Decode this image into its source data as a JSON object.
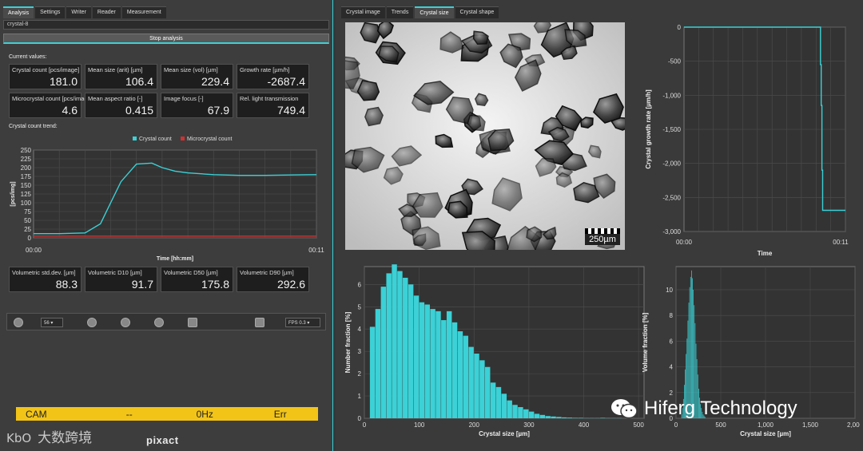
{
  "left_tabs": [
    {
      "label": "Analysis",
      "active": true
    },
    {
      "label": "Settings",
      "active": false
    },
    {
      "label": "Writer",
      "active": false
    },
    {
      "label": "Reader",
      "active": false
    },
    {
      "label": "Measurement",
      "active": false
    }
  ],
  "name_field": {
    "value": "crystal-8"
  },
  "stop_button": {
    "label": "Stop analysis"
  },
  "current_values_label": "Current values:",
  "current_values": [
    {
      "label": "Crystal count [pcs/image]",
      "value": "181.0"
    },
    {
      "label": "Mean size (arit) [µm]",
      "value": "106.4"
    },
    {
      "label": "Mean size (vol) [µm]",
      "value": "229.4"
    },
    {
      "label": "Growth rate [µm/h]",
      "value": "-2687.4"
    },
    {
      "label": "Microcrystal count [pcs/image]",
      "value": "4.6"
    },
    {
      "label": "Mean aspect ratio [-]",
      "value": "0.415"
    },
    {
      "label": "Image focus [-]",
      "value": "67.9"
    },
    {
      "label": "Rel. light transmission",
      "value": "749.4"
    }
  ],
  "trend_label": "Crystal count trend:",
  "volumetric_values": [
    {
      "label": "Volumetric std.dev. [µm]",
      "value": "88.3"
    },
    {
      "label": "Volumetric D10 [µm]",
      "value": "91.7"
    },
    {
      "label": "Volumetric D50 [µm]",
      "value": "175.8"
    },
    {
      "label": "Volumetric D90 [µm]",
      "value": "292.6"
    }
  ],
  "controls": {
    "frame_value": "56",
    "fps_label": "FPS",
    "fps_value": "0.3"
  },
  "status_bar": {
    "source": "CAM",
    "mid": "--",
    "rate": "0Hz",
    "state": "Err",
    "color": "#f2c418"
  },
  "brand": "pixact",
  "watermark_left": {
    "logo": "KbO",
    "text": "大数跨境"
  },
  "right_tabs": [
    {
      "label": "Crystal image",
      "active": false
    },
    {
      "label": "Trends",
      "active": false
    },
    {
      "label": "Crystal size",
      "active": true
    },
    {
      "label": "Crystal shape",
      "active": false
    }
  ],
  "scale_bar": "250µm",
  "watermark_right": "Hiferg Technology",
  "colors": {
    "accent": "#3bd1d6",
    "micro": "#d03030",
    "panel": "#3d3d3d"
  },
  "chart_data": [
    {
      "id": "trend",
      "type": "line",
      "legend": [
        "Crystal count",
        "Microcrystal count"
      ],
      "legend_position": "top-center",
      "ylabel": "[pcs/img]",
      "xlabel": "Time [hh:mm]",
      "x_ticks": [
        "00:00",
        "00:11"
      ],
      "y_ticks": [
        0,
        25,
        50,
        75,
        100,
        125,
        150,
        175,
        200,
        225,
        250
      ],
      "ylim": [
        0,
        250
      ],
      "xlim": [
        0,
        11
      ],
      "grid": true,
      "series": [
        {
          "name": "Crystal count",
          "color": "#3bd1d6",
          "x": [
            0,
            1,
            2,
            2.6,
            3.0,
            3.4,
            4.0,
            4.6,
            5.0,
            5.5,
            6,
            7,
            8,
            9,
            10,
            11
          ],
          "y": [
            12,
            12,
            14,
            40,
            100,
            160,
            210,
            213,
            200,
            190,
            185,
            180,
            178,
            178,
            179,
            180
          ]
        },
        {
          "name": "Microcrystal count",
          "color": "#d03030",
          "x": [
            0,
            11
          ],
          "y": [
            5,
            5
          ]
        }
      ]
    },
    {
      "id": "growth",
      "type": "line",
      "ylabel": "Crystal growth rate [µm/h]",
      "xlabel": "Time",
      "x_ticks": [
        "00:00",
        "00:11"
      ],
      "y_ticks": [
        0,
        -500,
        -1000,
        -1500,
        -2000,
        -2500,
        -3000
      ],
      "y_tick_labels": [
        "0",
        "-500",
        "-1,000",
        "-1,500",
        "-2,000",
        "-2,500",
        "-3,000"
      ],
      "ylim": [
        -3000,
        0
      ],
      "xlim": [
        0,
        11
      ],
      "grid": true,
      "series": [
        {
          "name": "",
          "color": "#3bd1d6",
          "x": [
            0,
            9.3,
            9.3,
            9.35,
            9.35,
            9.4,
            9.4,
            9.45,
            9.45,
            11
          ],
          "y": [
            0,
            0,
            -550,
            -550,
            -1150,
            -1150,
            -2100,
            -2100,
            -2690,
            -2690
          ]
        }
      ]
    },
    {
      "id": "number_dist",
      "type": "bar",
      "ylabel": "Number fraction [%]",
      "xlabel": "Crystal size [µm]",
      "xlim": [
        0,
        510
      ],
      "ylim": [
        0,
        6.8
      ],
      "x_ticks": [
        0,
        100,
        200,
        300,
        400,
        500
      ],
      "y_ticks": [
        0,
        1,
        2,
        3,
        4,
        5,
        6
      ],
      "bin_width": 10,
      "bin_start": 10,
      "values": [
        4.1,
        4.9,
        5.9,
        6.5,
        6.9,
        6.6,
        6.3,
        6.0,
        5.5,
        5.2,
        5.1,
        4.9,
        4.8,
        4.4,
        4.8,
        4.3,
        3.9,
        3.7,
        3.2,
        2.9,
        2.6,
        2.3,
        1.6,
        1.4,
        1.1,
        0.8,
        0.6,
        0.5,
        0.4,
        0.3,
        0.2,
        0.15,
        0.1,
        0.08,
        0.06,
        0.04,
        0.03,
        0.02,
        0.02,
        0.01,
        0.01,
        0.01,
        0.02,
        0.01,
        0.01,
        0.01
      ]
    },
    {
      "id": "volume_dist",
      "type": "bar",
      "ylabel": "Volume fraction [%]",
      "xlabel": "Crystal size [µm]",
      "xlim": [
        0,
        2000
      ],
      "ylim": [
        0,
        11.8
      ],
      "x_ticks": [
        0,
        500,
        1000,
        1500,
        2000
      ],
      "x_tick_labels": [
        "0",
        "500",
        "1,000",
        "1,500",
        "2,000"
      ],
      "y_ticks": [
        0,
        2,
        4,
        6,
        8,
        10
      ],
      "bin_width": 10,
      "bin_start": 60,
      "values": [
        0.3,
        0.8,
        1.5,
        2.6,
        3.8,
        5.0,
        6.2,
        7.6,
        9.0,
        10.2,
        11.0,
        11.5,
        10.9,
        10.0,
        8.8,
        7.4,
        5.8,
        4.6,
        3.4,
        2.3,
        1.6,
        1.1,
        0.8,
        0.5,
        0.3,
        0.2,
        0.1
      ]
    }
  ]
}
